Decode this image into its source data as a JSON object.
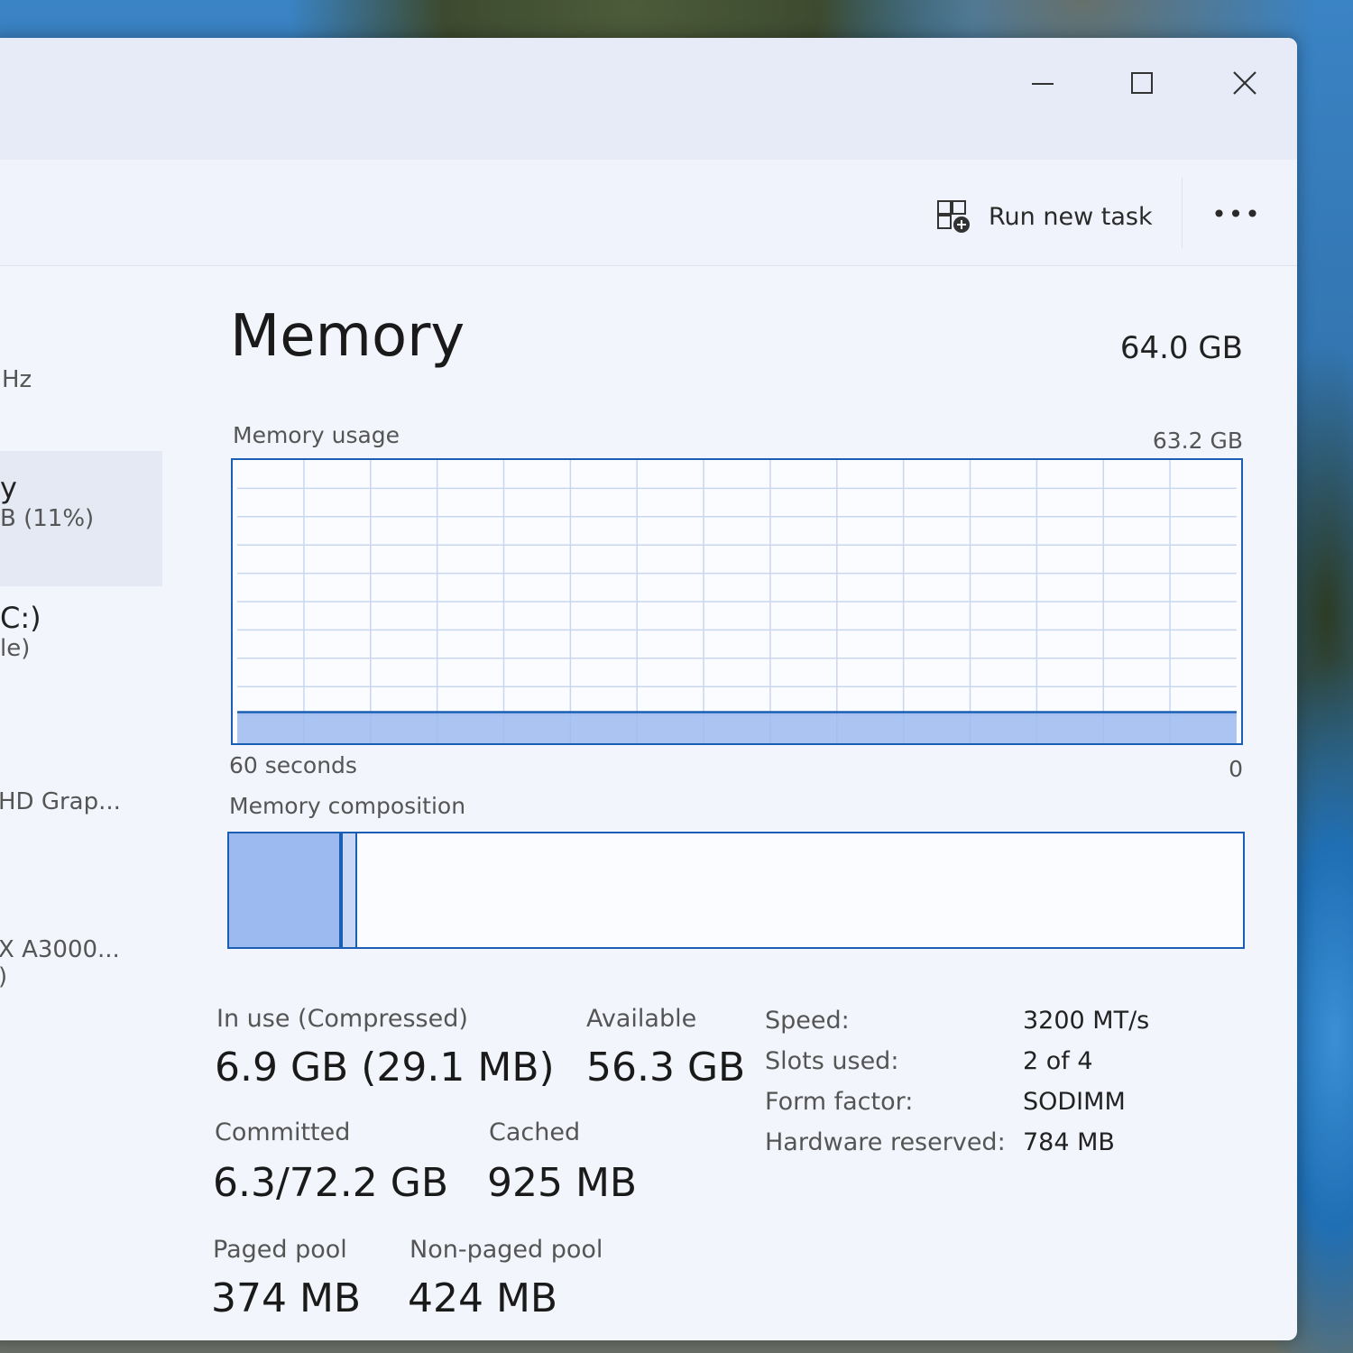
{
  "window": {
    "minimize_icon": "minimize-icon",
    "maximize_icon": "maximize-icon",
    "close_icon": "close-icon"
  },
  "toolbar": {
    "run_new_task_label": "Run new task",
    "run_new_task_icon": "run-task-icon",
    "more_label": "•••"
  },
  "sidebar": {
    "items": [
      {
        "line1": "",
        "line2": "Hz"
      },
      {
        "line1": "y",
        "line2": "B (11%)"
      },
      {
        "line1": "C:)",
        "line2": "le)"
      },
      {
        "line1": "",
        "line2": "HD Grap..."
      },
      {
        "line1": "X A3000...",
        "line2": ")"
      }
    ]
  },
  "memory": {
    "title": "Memory",
    "total": "64.0 GB",
    "usage_label": "Memory usage",
    "usage_max": "63.2 GB",
    "time_left": "60 seconds",
    "time_right": "0",
    "usage_fraction": 0.11,
    "composition_label": "Memory composition",
    "composition": {
      "in_use_fraction": 0.112,
      "modified_fraction": 0.014
    },
    "stats": {
      "in_use_label": "In use (Compressed)",
      "in_use_value": "6.9 GB (29.1 MB)",
      "available_label": "Available",
      "available_value": "56.3 GB",
      "committed_label": "Committed",
      "committed_value": "6.3/72.2 GB",
      "cached_label": "Cached",
      "cached_value": "925 MB",
      "paged_label": "Paged pool",
      "paged_value": "374 MB",
      "nonpaged_label": "Non-paged pool",
      "nonpaged_value": "424 MB"
    },
    "details": {
      "speed_label": "Speed:",
      "speed_value": "3200 MT/s",
      "slots_label": "Slots used:",
      "slots_value": "2 of 4",
      "form_label": "Form factor:",
      "form_value": "SODIMM",
      "hw_label": "Hardware reserved:",
      "hw_value": "784 MB"
    }
  },
  "colors": {
    "accent": "#1a5fb4",
    "fill": "#9dbaf0"
  }
}
